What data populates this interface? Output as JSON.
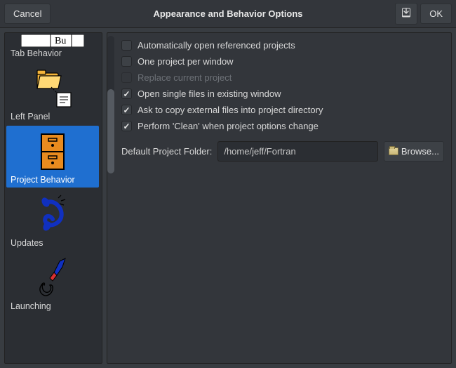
{
  "titlebar": {
    "cancel": "Cancel",
    "title": "Appearance and Behavior Options",
    "ok": "OK"
  },
  "sidebar": {
    "items": [
      {
        "label": "Tab Behavior"
      },
      {
        "label": "Left Panel"
      },
      {
        "label": "Project Behavior"
      },
      {
        "label": "Updates"
      },
      {
        "label": "Launching"
      }
    ]
  },
  "options": {
    "checks": [
      {
        "label": "Automatically open referenced projects",
        "checked": false,
        "disabled": false
      },
      {
        "label": "One project per window",
        "checked": false,
        "disabled": false
      },
      {
        "label": "Replace current project",
        "checked": false,
        "disabled": true
      },
      {
        "label": "Open single files in existing window",
        "checked": true,
        "disabled": false
      },
      {
        "label": "Ask to copy external files into project directory",
        "checked": true,
        "disabled": false
      },
      {
        "label": "Perform 'Clean' when project options change",
        "checked": true,
        "disabled": false
      }
    ],
    "folder_label": "Default Project Folder:",
    "folder_value": "/home/jeff/Fortran",
    "browse_label": "Browse..."
  }
}
